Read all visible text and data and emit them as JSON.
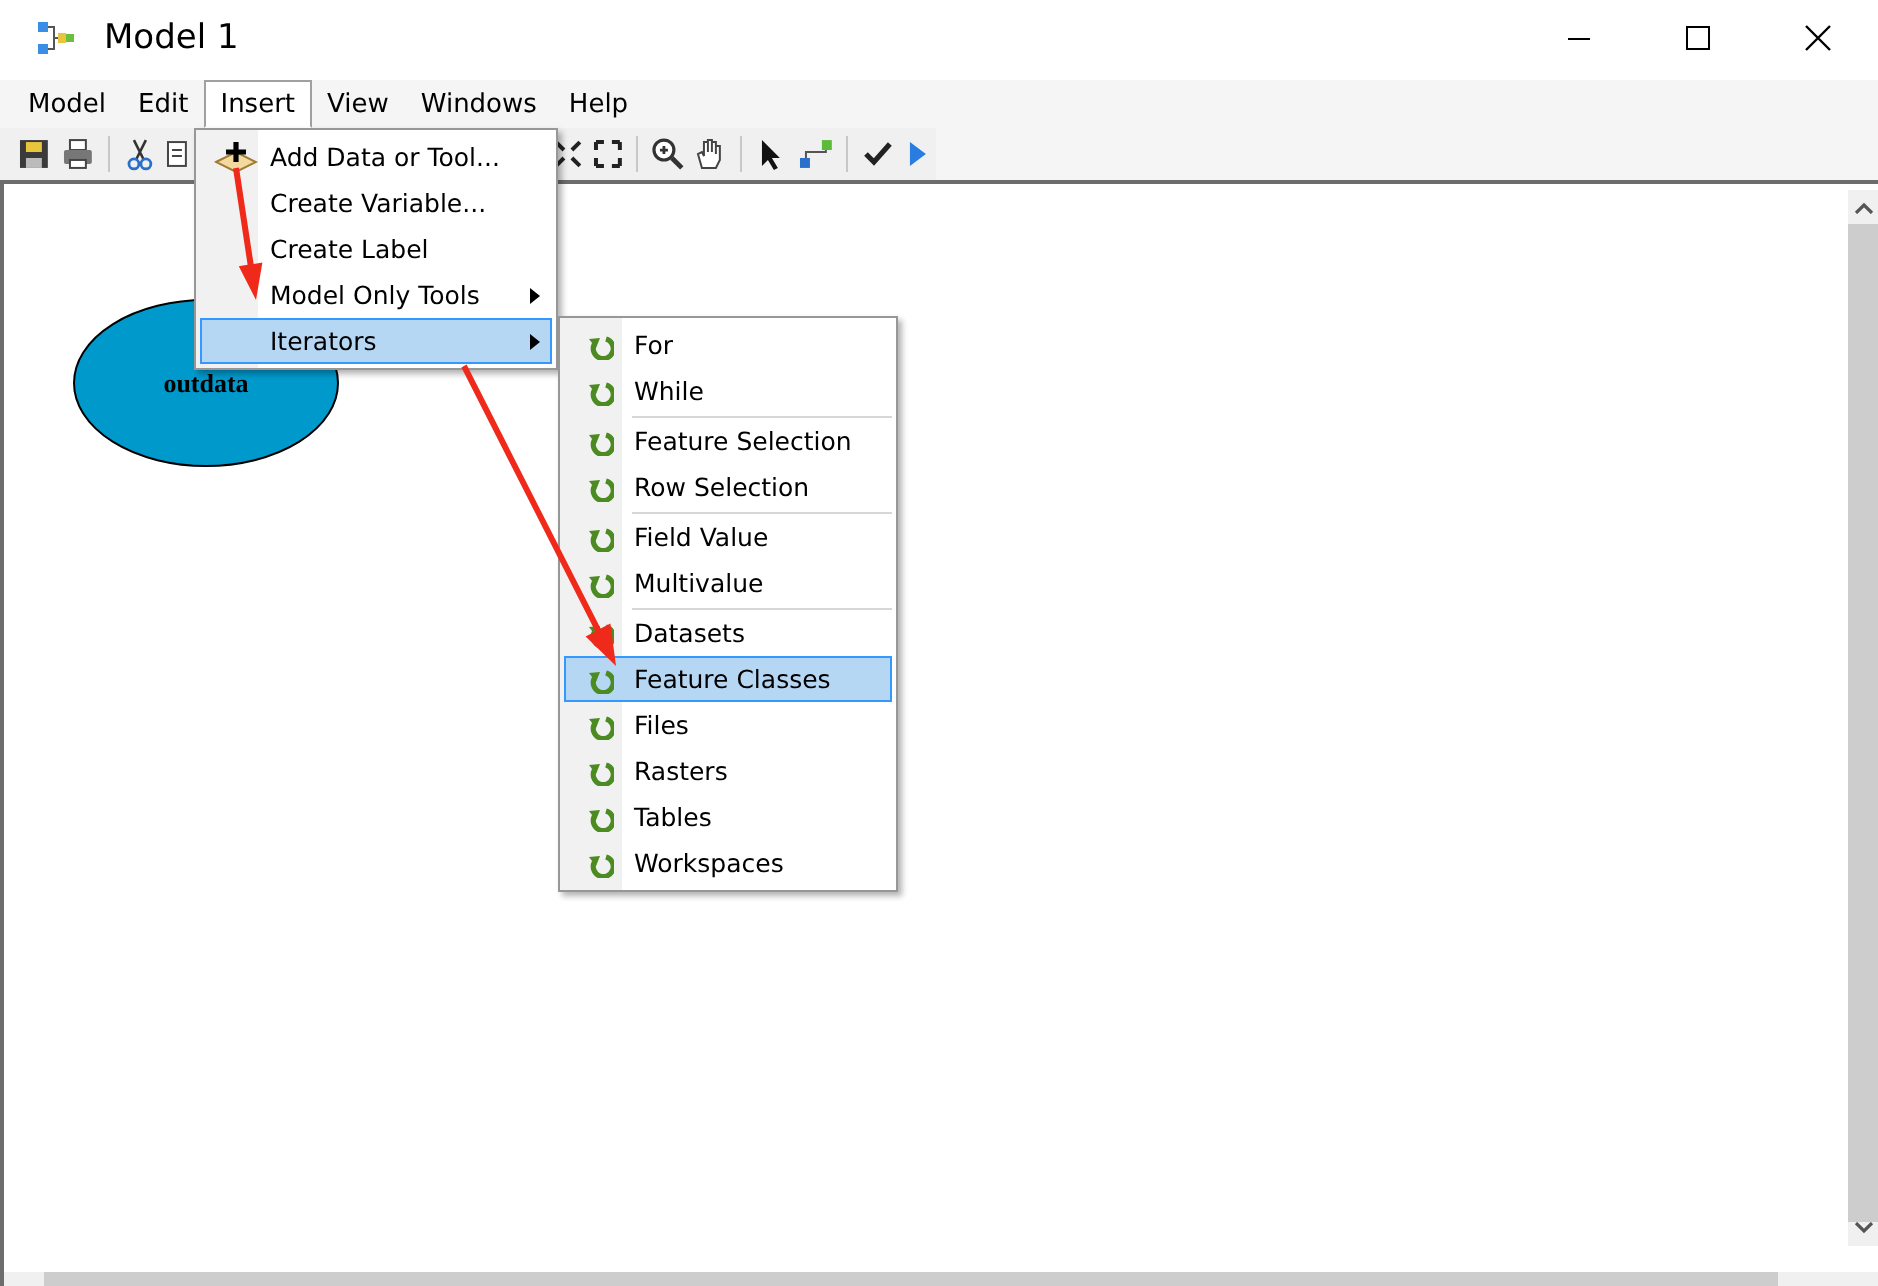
{
  "window": {
    "title": "Model 1"
  },
  "menu_bar": [
    {
      "label": "Model",
      "selected": false
    },
    {
      "label": "Edit",
      "selected": false
    },
    {
      "label": "Insert",
      "selected": true
    },
    {
      "label": "View",
      "selected": false
    },
    {
      "label": "Windows",
      "selected": false
    },
    {
      "label": "Help",
      "selected": false
    }
  ],
  "insert_menu": {
    "items": [
      {
        "label": "Add Data or Tool...",
        "kind": "add",
        "selected": false
      },
      {
        "label": "Create Variable...",
        "kind": "command",
        "selected": false
      },
      {
        "label": "Create Label",
        "kind": "command",
        "selected": false
      },
      {
        "label": "Model Only Tools",
        "kind": "submenu",
        "selected": false
      },
      {
        "label": "Iterators",
        "kind": "submenu",
        "selected": true
      }
    ]
  },
  "iterators_menu": {
    "groups": [
      {
        "items": [
          {
            "label": "For",
            "selected": false
          },
          {
            "label": "While",
            "selected": false
          }
        ]
      },
      {
        "items": [
          {
            "label": "Feature Selection",
            "selected": false
          },
          {
            "label": "Row Selection",
            "selected": false
          }
        ]
      },
      {
        "items": [
          {
            "label": "Field Value",
            "selected": false
          },
          {
            "label": "Multivalue",
            "selected": false
          }
        ]
      },
      {
        "items": [
          {
            "label": "Datasets",
            "selected": false
          },
          {
            "label": "Feature Classes",
            "selected": true
          },
          {
            "label": "Files",
            "selected": false
          },
          {
            "label": "Rasters",
            "selected": false
          },
          {
            "label": "Tables",
            "selected": false
          },
          {
            "label": "Workspaces",
            "selected": false
          }
        ]
      }
    ]
  },
  "canvas": {
    "nodes": [
      {
        "label": "outdata",
        "kind": "variable"
      }
    ]
  }
}
